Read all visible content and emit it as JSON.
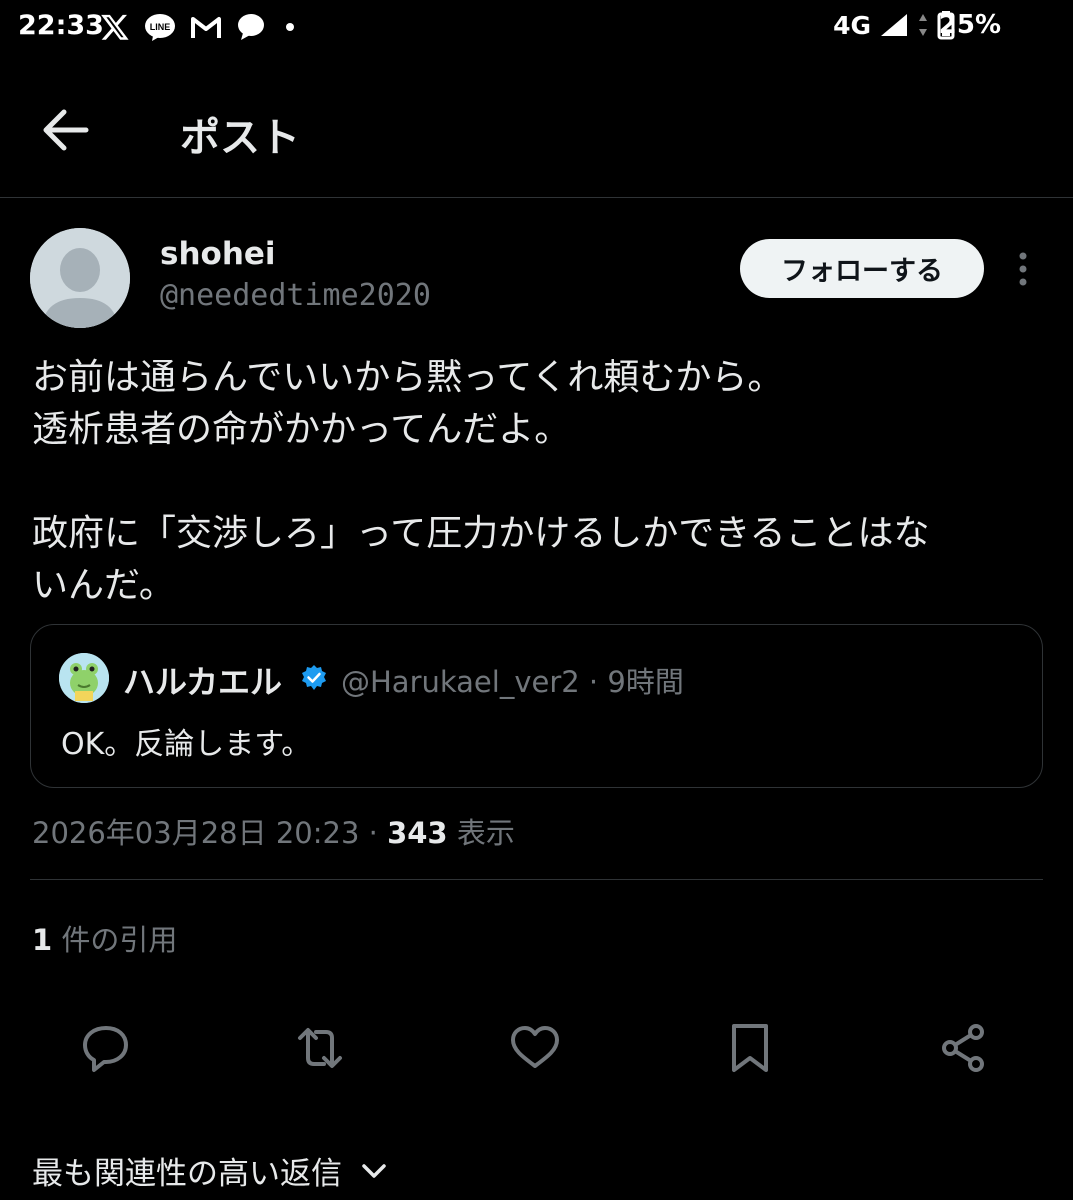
{
  "status_bar": {
    "time": "22:33",
    "network": "4G",
    "battery": "25%",
    "left_icons": [
      "x-icon",
      "line-icon",
      "gmail-icon",
      "chat-icon",
      "dot-icon"
    ]
  },
  "header": {
    "title": "ポスト"
  },
  "author": {
    "name": "shohei",
    "handle": "@neededtime2020",
    "follow_label": "フォローする"
  },
  "tweet": {
    "text": "お前は通らんでいいから黙ってくれ頼むから。\n透析患者の命がかかってんだよ。\n\n政府に「交渉しろ」って圧力かけるしかできることはな\nいんだ。"
  },
  "quoted_post": {
    "name": "ハルカエル",
    "handle_time": "@Harukael_ver2 · 9時間",
    "text": "OK。反論します。"
  },
  "meta": {
    "datetime": "2026年03月28日 20:23 · ",
    "views_count": "343",
    "views_label": " 表示"
  },
  "quotes": {
    "count": "1",
    "label": " 件の引用"
  },
  "actions": [
    "reply-icon",
    "repost-icon",
    "like-icon",
    "bookmark-icon",
    "share-icon"
  ],
  "replies_sort": {
    "label": "最も関連性の高い返信"
  },
  "colors": {
    "background": "#000000",
    "text": "#e7e9ea",
    "secondary": "#71767b",
    "verified": "#1d9bf0"
  }
}
